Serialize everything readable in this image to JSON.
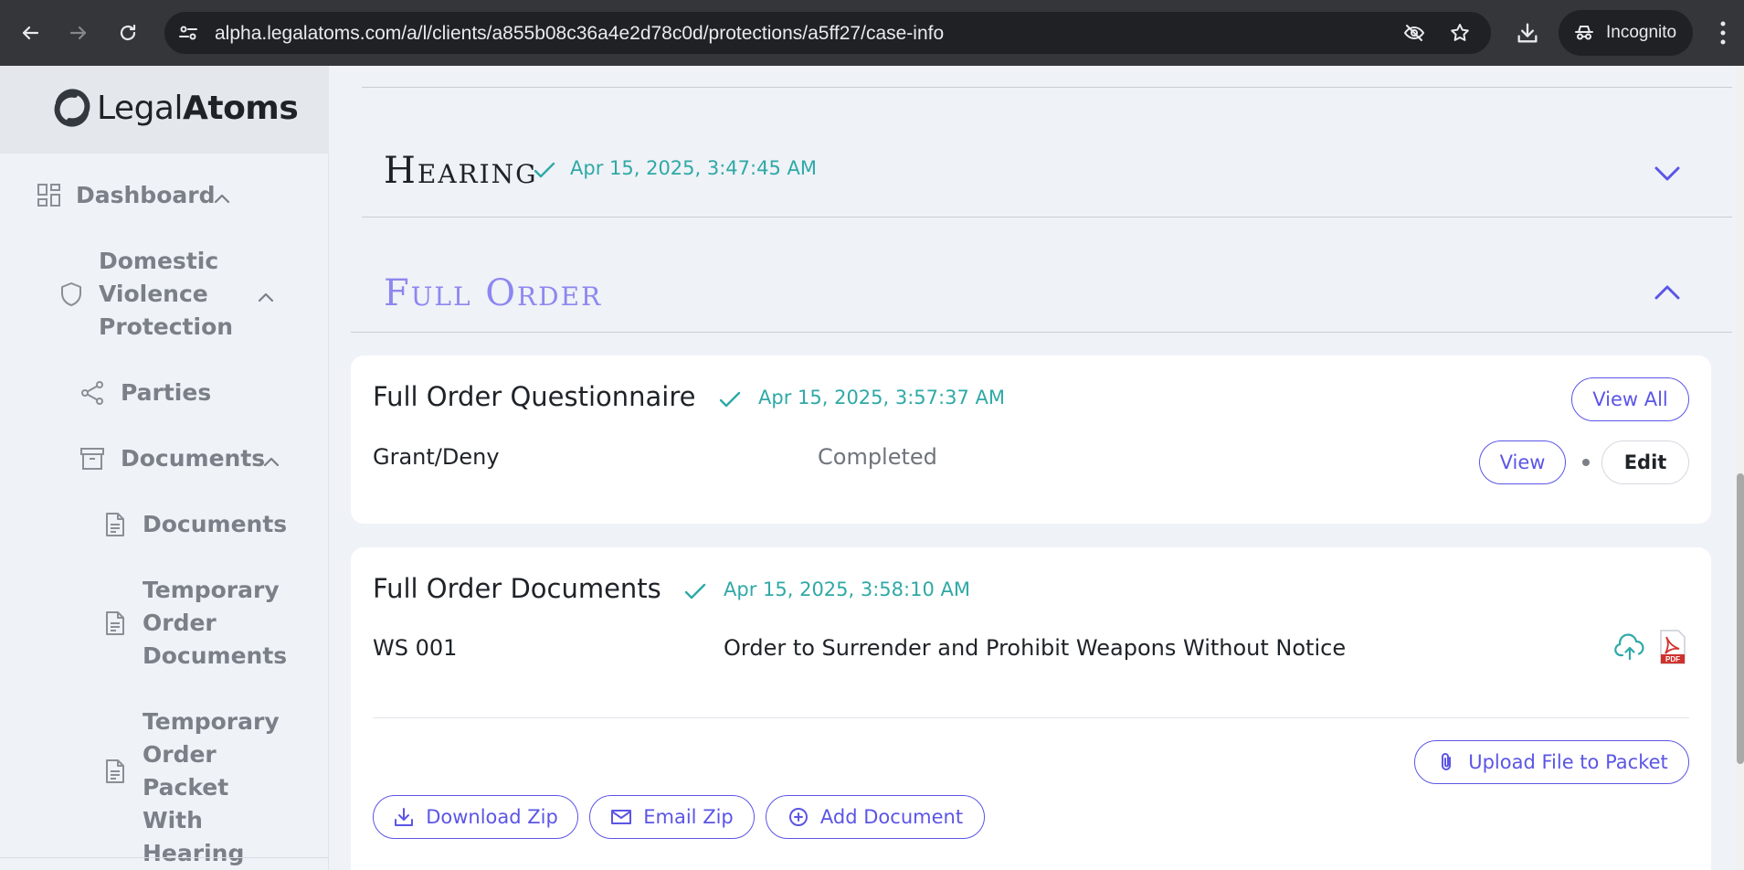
{
  "browser": {
    "url": "alpha.legalatoms.com/a/l/clients/a855b08c36a4e2d78c0d/protections/a5ff27/case-info",
    "incognito_label": "Incognito"
  },
  "brand": {
    "name_light": "Legal",
    "name_bold": "Atoms"
  },
  "sidebar": {
    "items": [
      {
        "label": "Dashboard",
        "icon": "grid-icon"
      },
      {
        "label": "Domestic\nViolence\nProtection",
        "icon": "shield-icon"
      },
      {
        "label": "Parties",
        "icon": "share-icon"
      },
      {
        "label": "Documents",
        "icon": "archive-icon"
      },
      {
        "label": "Documents",
        "icon": "file-icon"
      },
      {
        "label": "Temporary\nOrder\nDocuments",
        "icon": "file-icon"
      },
      {
        "label": "Temporary\nOrder\nPacket With\nHearing",
        "icon": "file-icon"
      }
    ]
  },
  "sections": {
    "hearing": {
      "title": "Hearing",
      "timestamp": "Apr 15, 2025, 3:47:45 AM"
    },
    "full_order": {
      "title": "Full Order"
    }
  },
  "questionnaire": {
    "title": "Full Order Questionnaire",
    "timestamp": "Apr 15, 2025, 3:57:37 AM",
    "view_all_label": "View All",
    "row": {
      "name": "Grant/Deny",
      "status": "Completed",
      "view_label": "View",
      "edit_label": "Edit"
    }
  },
  "documents": {
    "title": "Full Order Documents",
    "timestamp": "Apr 15, 2025, 3:58:10 AM",
    "rows": [
      {
        "code": "WS 001",
        "name": "Order to Surrender and Prohibit Weapons Without Notice"
      }
    ],
    "upload_label": "Upload File to Packet",
    "download_zip_label": "Download Zip",
    "email_zip_label": "Email Zip",
    "add_document_label": "Add Document"
  },
  "colors": {
    "accent": "#5b55e6",
    "teal": "#2fa9a6",
    "background": "#eff2f7"
  }
}
